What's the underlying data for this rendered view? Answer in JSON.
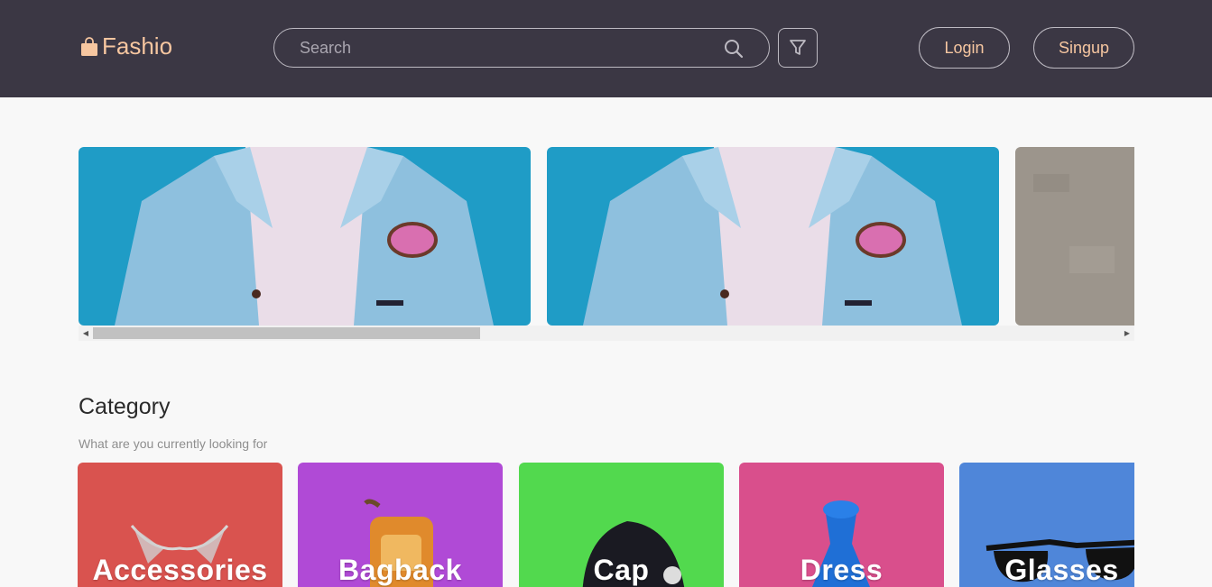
{
  "header": {
    "logo_text": "Fashio",
    "search_placeholder": "Search",
    "login_label": "Login",
    "signup_label": "Singup"
  },
  "colors": {
    "header_bg": "#3b3744",
    "accent": "#f6c6a0",
    "page_bg": "#f8f8f8"
  },
  "category_section": {
    "title": "Category",
    "subtitle": "What are you currently looking for",
    "items": [
      {
        "label": "Accessories",
        "color": "#d9534f"
      },
      {
        "label": "Bagback",
        "color": "#b04ad6"
      },
      {
        "label": "Cap",
        "color": "#52d94e"
      },
      {
        "label": "Dress",
        "color": "#d94f8c"
      },
      {
        "label": "Glasses",
        "color": "#4f86d9"
      }
    ]
  }
}
